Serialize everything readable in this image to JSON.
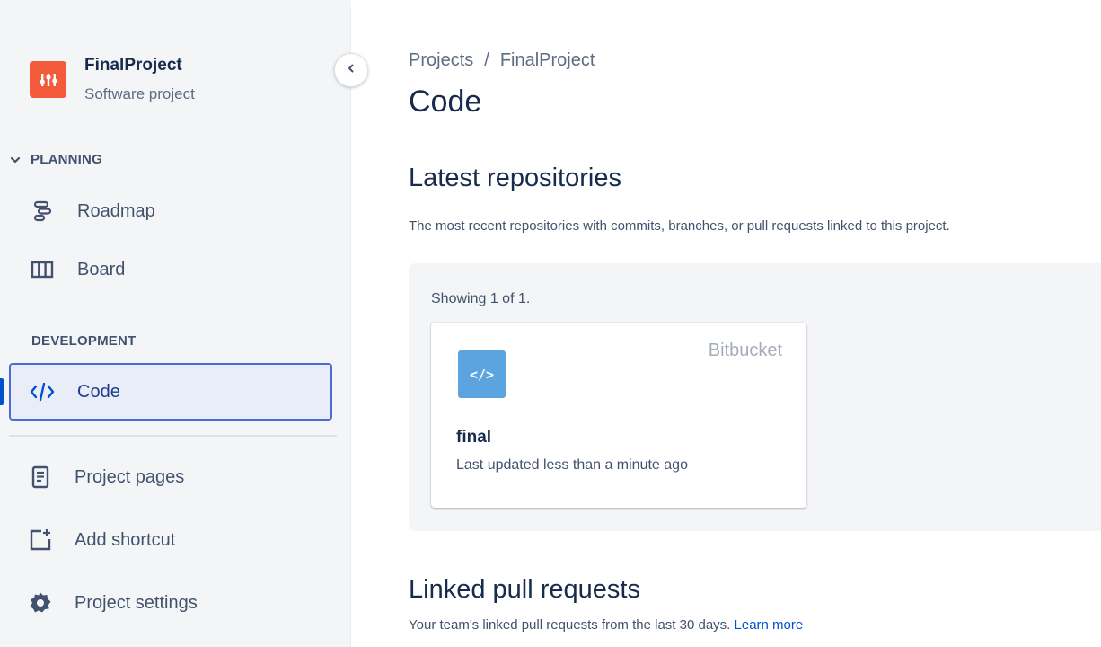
{
  "sidebar": {
    "project": {
      "name": "FinalProject",
      "type": "Software project",
      "avatar_color": "#F25C3B"
    },
    "sections": {
      "planning": "PLANNING",
      "development": "DEVELOPMENT"
    },
    "items": [
      {
        "label": "Roadmap",
        "icon": "roadmap-icon"
      },
      {
        "label": "Board",
        "icon": "board-icon"
      },
      {
        "label": "Code",
        "icon": "code-icon",
        "selected": true
      },
      {
        "label": "Project pages",
        "icon": "page-icon"
      },
      {
        "label": "Add shortcut",
        "icon": "add-shortcut-icon"
      },
      {
        "label": "Project settings",
        "icon": "gear-icon"
      }
    ]
  },
  "main": {
    "breadcrumb": {
      "root": "Projects",
      "separator": "/",
      "current": "FinalProject"
    },
    "title": "Code",
    "latest": {
      "title": "Latest repositories",
      "description": "The most recent repositories with commits, branches, or pull requests linked to this project.",
      "showing": "Showing 1 of 1.",
      "repo": {
        "source": "Bitbucket",
        "icon_glyph": "</>",
        "name": "final",
        "updated": "Last updated less than a minute ago"
      }
    },
    "linked": {
      "title": "Linked pull requests",
      "description": "Your team's linked pull requests from the last 30 days.",
      "learn_more": "Learn more"
    }
  },
  "colors": {
    "accent": "#0052CC",
    "selected_bg": "#E9EDF8",
    "repo_icon": "#5BA4E0"
  }
}
